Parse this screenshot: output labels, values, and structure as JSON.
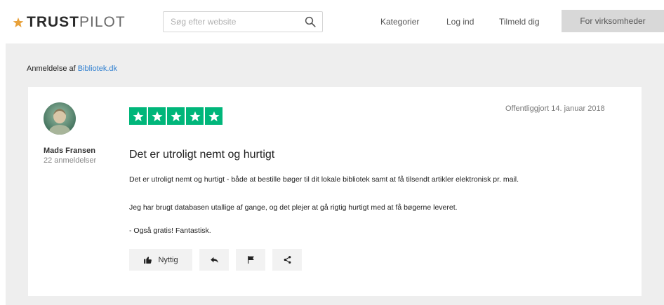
{
  "header": {
    "logo_strong": "TRUST",
    "logo_light": "PILOT",
    "search_placeholder": "Søg efter website",
    "nav": {
      "categories": "Kategorier",
      "login": "Log ind",
      "signup": "Tilmeld dig"
    },
    "business_button": "For virksomheder"
  },
  "breadcrumb": {
    "prefix": "Anmeldelse af",
    "link": "Bibliotek.dk"
  },
  "review": {
    "author_name": "Mads Fransen",
    "author_reviews": "22 anmeldelser",
    "rating": 5,
    "published": "Offentliggjort 14. januar 2018",
    "title": "Det er utroligt nemt og hurtigt",
    "paragraphs": [
      "Det er utroligt nemt og hurtigt - både at bestille bøger til dit lokale bibliotek samt at få tilsendt artikler elektronisk pr. mail.",
      "Jeg har brugt databasen utallige af gange, og det plejer at gå rigtig hurtigt med at få bøgerne leveret.",
      "- Også gratis! Fantastisk."
    ],
    "useful_label": "Nyttig"
  },
  "icons": {
    "logo": "star-icon",
    "search": "magnifier-icon",
    "useful": "thumbs-up-icon",
    "reply": "reply-arrow-icon",
    "report": "flag-icon",
    "share": "share-icon"
  },
  "colors": {
    "brand_green": "#00b67a",
    "logo_star": "#e8a13a",
    "link_blue": "#2f7fd0",
    "background_grey": "#eeeeee",
    "business_button": "#d8d8d8"
  }
}
